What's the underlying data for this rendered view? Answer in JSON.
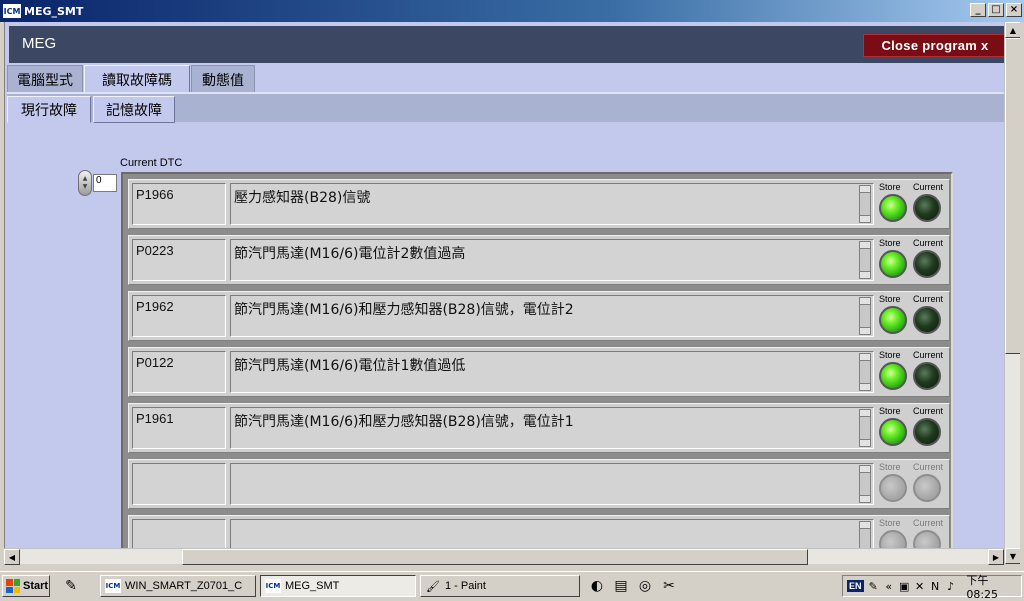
{
  "window": {
    "icon": "ICM",
    "title": "MEG_SMT",
    "controls": [
      "_",
      "□",
      "×"
    ]
  },
  "app": {
    "header_title": "MEG",
    "close_label": "Close program x"
  },
  "tabs": {
    "level1": [
      {
        "label": "電腦型式",
        "active": false
      },
      {
        "label": "讀取故障碼",
        "active": true
      },
      {
        "label": "動態值",
        "active": false
      }
    ],
    "level2": [
      {
        "label": "現行故障",
        "active": true
      },
      {
        "label": "記憶故障",
        "active": false
      }
    ]
  },
  "dtc": {
    "section_label": "Current DTC",
    "index_value": "0",
    "store_label": "Store",
    "current_label": "Current",
    "rows": [
      {
        "code": "P1966",
        "description": "壓力感知器(B28)信號",
        "store_on": true,
        "current_on": false
      },
      {
        "code": "P0223",
        "description": "節汽門馬達(M16/6)電位計2數值過高",
        "store_on": true,
        "current_on": false
      },
      {
        "code": "P1962",
        "description": "節汽門馬達(M16/6)和壓力感知器(B28)信號，電位計2",
        "store_on": true,
        "current_on": false
      },
      {
        "code": "P0122",
        "description": "節汽門馬達(M16/6)電位計1數值過低",
        "store_on": true,
        "current_on": false
      },
      {
        "code": "P1961",
        "description": "節汽門馬達(M16/6)和壓力感知器(B28)信號，電位計1",
        "store_on": true,
        "current_on": false
      },
      {
        "code": "",
        "description": "",
        "store_on": false,
        "current_on": false
      },
      {
        "code": "",
        "description": "",
        "store_on": false,
        "current_on": false
      }
    ]
  },
  "taskbar": {
    "start_label": "Start",
    "buttons": [
      {
        "label": "WIN_SMART_Z0701_C",
        "icon": "ICM",
        "pressed": false
      },
      {
        "label": "MEG_SMT",
        "icon": "ICM",
        "pressed": true
      },
      {
        "label": "1 - Paint",
        "icon": "paint-icon",
        "pressed": false
      }
    ],
    "language": "EN",
    "clock": "下午 08:25"
  }
}
